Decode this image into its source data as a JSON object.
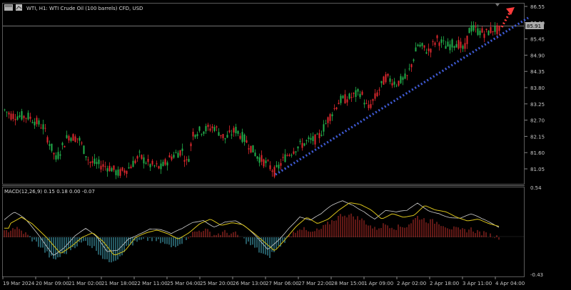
{
  "header": {
    "symbol_title": "WTI, H1:  WTI Crude Oil (100 barrels) CFD, USD",
    "flag_icon": "chart-window-icon"
  },
  "price_axis": {
    "labels": [
      "86.55",
      "86.00",
      "85.45",
      "84.90",
      "84.35",
      "83.80",
      "83.25",
      "82.70",
      "82.15",
      "81.60",
      "81.05"
    ],
    "current_price": "85.91"
  },
  "macd": {
    "title": "MACD(12,26,9) 0.15 0.18 0.00 -0.07",
    "axis_top": "0.54",
    "axis_bottom": "-0.43"
  },
  "time_axis": {
    "labels": [
      "19 Mar 2024",
      "20 Mar 09:00",
      "21 Mar 02:00",
      "21 Mar 18:00",
      "22 Mar 11:00",
      "25 Mar 04:00",
      "25 Mar 20:00",
      "26 Mar 13:00",
      "27 Mar 06:00",
      "27 Mar 22:00",
      "28 Mar 15:00",
      "1 Apr 09:00",
      "2 Apr 02:00",
      "2 Apr 18:00",
      "3 Apr 11:00",
      "4 Apr 04:00"
    ]
  },
  "colors": {
    "background": "#000000",
    "bull_candle": "#22b14c",
    "bear_candle": "#e0282e",
    "trendline": "#3f5bd6",
    "projection": "#ff3b3b",
    "macd_line": "#d0d0d0",
    "signal_line": "#d8c21a",
    "hist_pos": "#c0302a",
    "hist_neg": "#4ab3c7"
  },
  "chart_data": {
    "type": "candlestick",
    "price_range": [
      80.8,
      86.75
    ],
    "macd_range": [
      -0.43,
      0.54
    ]
  }
}
